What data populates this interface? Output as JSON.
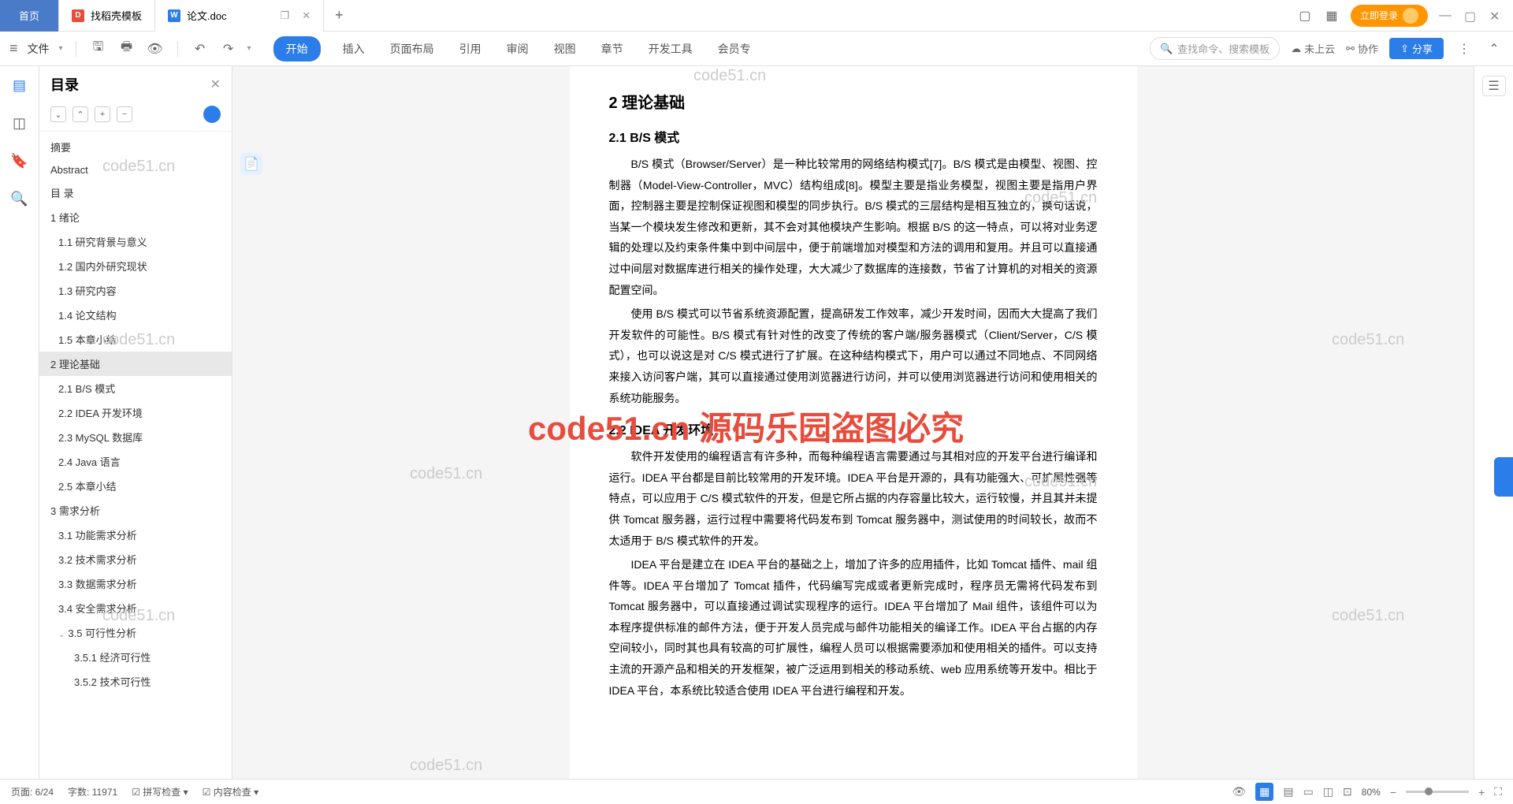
{
  "tabs": {
    "home": "首页",
    "t1": "找稻壳模板",
    "t2": "论文.doc"
  },
  "titlebar": {
    "login": "立即登录"
  },
  "toolbar": {
    "file": "文件",
    "menu": [
      "开始",
      "插入",
      "页面布局",
      "引用",
      "审阅",
      "视图",
      "章节",
      "开发工具",
      "会员专"
    ],
    "search_ph": "查找命令、搜索模板",
    "cloud": "未上云",
    "collab": "协作",
    "share": "分享"
  },
  "outline": {
    "title": "目录",
    "items": [
      {
        "t": "摘要",
        "l": 1
      },
      {
        "t": "Abstract",
        "l": 1
      },
      {
        "t": "目 录",
        "l": 1
      },
      {
        "t": "1 绪论",
        "l": 1
      },
      {
        "t": "1.1 研究背景与意义",
        "l": 2
      },
      {
        "t": "1.2 国内外研究现状",
        "l": 2
      },
      {
        "t": "1.3 研究内容",
        "l": 2
      },
      {
        "t": "1.4 论文结构",
        "l": 2
      },
      {
        "t": "1.5 本章小结",
        "l": 2
      },
      {
        "t": "2 理论基础",
        "l": 1,
        "active": true
      },
      {
        "t": "2.1 B/S 模式",
        "l": 2
      },
      {
        "t": "2.2 IDEA 开发环境",
        "l": 2
      },
      {
        "t": "2.3 MySQL 数据库",
        "l": 2
      },
      {
        "t": "2.4 Java 语言",
        "l": 2
      },
      {
        "t": "2.5 本章小结",
        "l": 2
      },
      {
        "t": "3 需求分析",
        "l": 1
      },
      {
        "t": "3.1 功能需求分析",
        "l": 2
      },
      {
        "t": "3.2 技术需求分析",
        "l": 2
      },
      {
        "t": "3.3 数据需求分析",
        "l": 2
      },
      {
        "t": "3.4 安全需求分析",
        "l": 2
      },
      {
        "t": "3.5 可行性分析",
        "l": 2,
        "chev": true
      },
      {
        "t": "3.5.1 经济可行性",
        "l": 3
      },
      {
        "t": "3.5.2 技术可行性",
        "l": 3
      }
    ]
  },
  "doc": {
    "h1": "2 理论基础",
    "s1_h": "2.1 B/S 模式",
    "s1_p1": "B/S 模式（Browser/Server）是一种比较常用的网络结构模式[7]。B/S 模式是由模型、视图、控制器（Model-View-Controller，MVC）结构组成[8]。模型主要是指业务模型，视图主要是指用户界面，控制器主要是控制保证视图和模型的同步执行。B/S 模式的三层结构是相互独立的，换句话说，当某一个模块发生修改和更新，其不会对其他模块产生影响。根据 B/S 的这一特点，可以将对业务逻辑的处理以及约束条件集中到中间层中，便于前端增加对模型和方法的调用和复用。并且可以直接通过中间层对数据库进行相关的操作处理，大大减少了数据库的连接数，节省了计算机的对相关的资源配置空间。",
    "s1_p2": "使用 B/S 模式可以节省系统资源配置，提高研发工作效率，减少开发时间，因而大大提高了我们开发软件的可能性。B/S 模式有针对性的改变了传统的客户端/服务器模式（Client/Server，C/S 模式），也可以说这是对 C/S 模式进行了扩展。在这种结构模式下，用户可以通过不同地点、不同网络来接入访问客户端，其可以直接通过使用浏览器进行访问，并可以使用浏览器进行访问和使用相关的系统功能服务。",
    "s2_h": "2.2 IDEA 开发环境",
    "s2_p1": "软件开发使用的编程语言有许多种，而每种编程语言需要通过与其相对应的开发平台进行编译和运行。IDEA 平台都是目前比较常用的开发环境。IDEA 平台是开源的，具有功能强大、可扩展性强等特点，可以应用于 C/S 模式软件的开发，但是它所占据的内存容量比较大，运行较慢，并且其并未提供 Tomcat 服务器，运行过程中需要将代码发布到 Tomcat 服务器中，测试使用的时间较长，故而不太适用于 B/S 模式软件的开发。",
    "s2_p2": "IDEA 平台是建立在 IDEA 平台的基础之上，增加了许多的应用插件，比如 Tomcat 插件、mail 组件等。IDEA 平台增加了 Tomcat 插件，代码编写完成或者更新完成时，程序员无需将代码发布到 Tomcat 服务器中，可以直接通过调试实现程序的运行。IDEA 平台增加了 Mail 组件，该组件可以为本程序提供标准的邮件方法，便于开发人员完成与邮件功能相关的编译工作。IDEA 平台占据的内存空间较小，同时其也具有较高的可扩展性，编程人员可以根据需要添加和使用相关的插件。可以支持主流的开源产品和相关的开发框架，被广泛运用到相关的移动系统、web 应用系统等开发中。相比于 IDEA 平台，本系统比较适合使用 IDEA 平台进行编程和开发。"
  },
  "status": {
    "page": "页面: 6/24",
    "words": "字数: 11971",
    "spell": "拼写检查",
    "content": "内容检查",
    "zoom": "80%"
  },
  "watermarks": {
    "grey": "code51.cn",
    "red": "code51.cn 源码乐园盗图必究"
  }
}
